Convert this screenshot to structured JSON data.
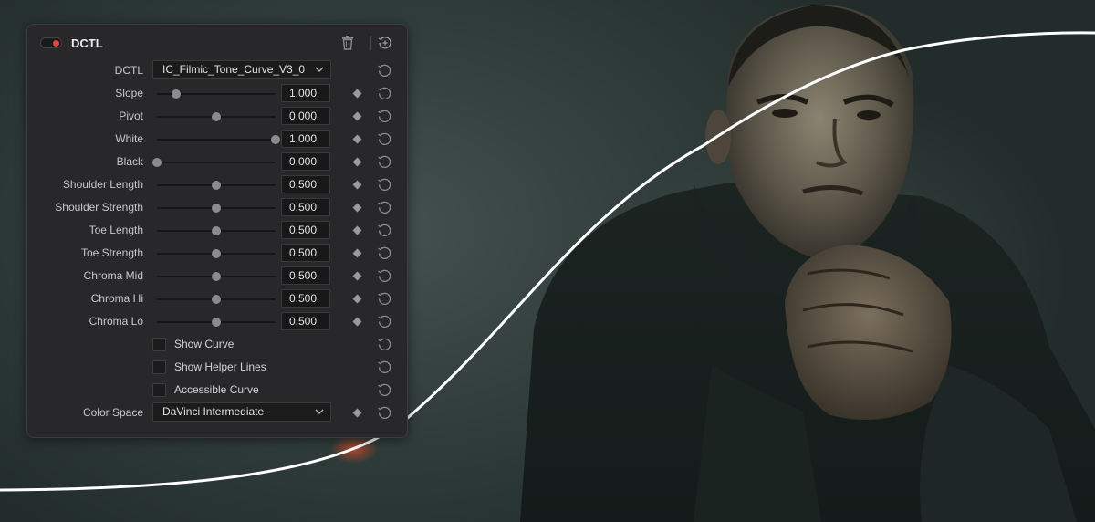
{
  "panel": {
    "title": "DCTL",
    "enabled": true,
    "dctl": {
      "label": "DCTL",
      "value": "IC_Filmic_Tone_Curve_V3_0"
    },
    "sliders": [
      {
        "label": "Slope",
        "value": "1.000",
        "level": 0.16
      },
      {
        "label": "Pivot",
        "value": "0.000",
        "level": 0.5
      },
      {
        "label": "White",
        "value": "1.000",
        "level": 1.0
      },
      {
        "label": "Black",
        "value": "0.000",
        "level": 0.0
      },
      {
        "label": "Shoulder Length",
        "value": "0.500",
        "level": 0.5
      },
      {
        "label": "Shoulder Strength",
        "value": "0.500",
        "level": 0.5
      },
      {
        "label": "Toe Length",
        "value": "0.500",
        "level": 0.5
      },
      {
        "label": "Toe Strength",
        "value": "0.500",
        "level": 0.5
      },
      {
        "label": "Chroma Mid",
        "value": "0.500",
        "level": 0.5
      },
      {
        "label": "Chroma Hi",
        "value": "0.500",
        "level": 0.5
      },
      {
        "label": "Chroma Lo",
        "value": "0.500",
        "level": 0.5
      }
    ],
    "checkboxes": [
      {
        "label": "Show Curve",
        "checked": false
      },
      {
        "label": "Show Helper Lines",
        "checked": false
      },
      {
        "label": "Accessible Curve",
        "checked": false
      }
    ],
    "color_space": {
      "label": "Color Space",
      "value": "DaVinci Intermediate"
    }
  },
  "colors": {
    "toggle_on": "#e8443a",
    "panel_bg": "#28282a",
    "curve": "#ffffff"
  },
  "icons": {
    "delete": "trash-icon",
    "reset": "reset-icon",
    "keyframe": "keyframe-diamond-icon",
    "dropdown": "chevron-down-icon"
  }
}
